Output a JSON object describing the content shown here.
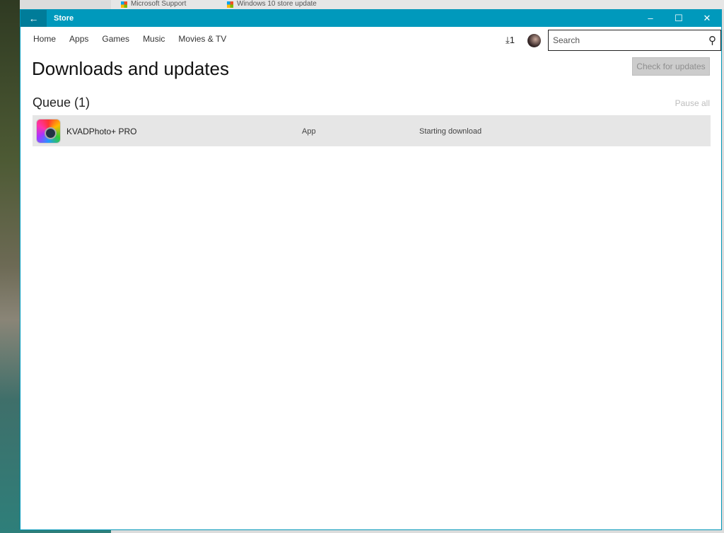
{
  "browser_tabs": [
    "Microsoft Support",
    "Windows 10 store update"
  ],
  "window": {
    "title": "Store",
    "back_icon": "arrow-left-icon",
    "accent": "#0099bc"
  },
  "nav": {
    "items": [
      "Home",
      "Apps",
      "Games",
      "Music",
      "Movies & TV"
    ]
  },
  "header": {
    "download_count": "1",
    "search_placeholder": "Search"
  },
  "page": {
    "title": "Downloads and updates",
    "check_updates": "Check for updates"
  },
  "queue": {
    "title": "Queue (1)",
    "pause_all": "Pause all",
    "items": [
      {
        "name": "KVADPhoto+ PRO",
        "type": "App",
        "status": "Starting download"
      }
    ]
  }
}
